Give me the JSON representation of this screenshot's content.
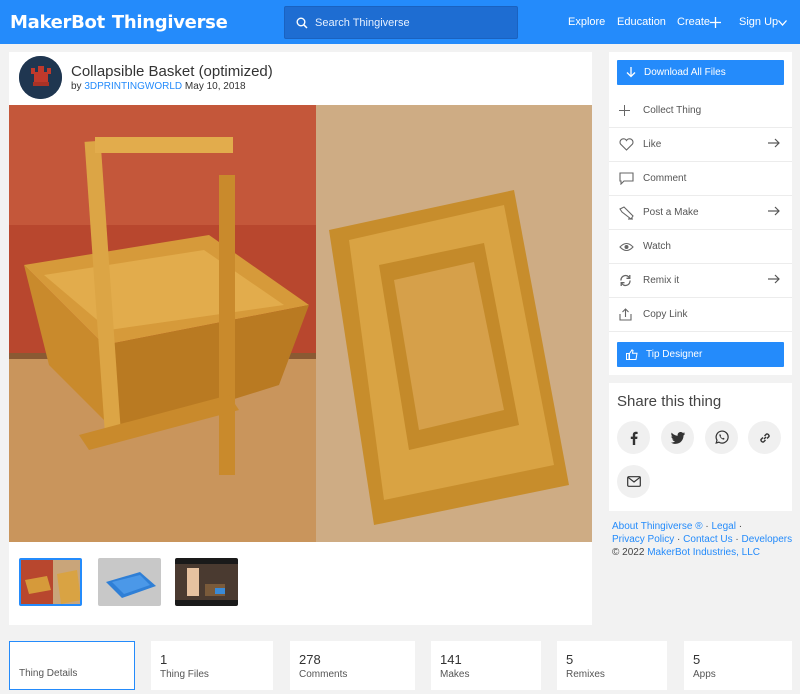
{
  "header": {
    "logo_brand": "MakerBot",
    "logo_product": "Thingiverse",
    "search_placeholder": "Search Thingiverse",
    "nav": {
      "explore": "Explore",
      "education": "Education",
      "create": "Create",
      "signup": "Sign Up"
    }
  },
  "thing": {
    "title": "Collapsible Basket (optimized)",
    "by_prefix": "by",
    "author": "3DPRINTINGWORLD",
    "date": "May 10, 2018"
  },
  "actions": {
    "download": "Download All Files",
    "collect": "Collect Thing",
    "like": "Like",
    "comment": "Comment",
    "post_make": "Post a Make",
    "watch": "Watch",
    "remix": "Remix it",
    "copy_link": "Copy Link",
    "tip": "Tip Designer"
  },
  "share": {
    "title": "Share this thing",
    "icons": [
      "facebook-icon",
      "twitter-icon",
      "whatsapp-icon",
      "link-icon",
      "email-icon"
    ]
  },
  "footer": {
    "about": "About Thingiverse ®",
    "legal": "Legal",
    "privacy": "Privacy Policy",
    "contact": "Contact Us",
    "developers": "Developers",
    "copyright_prefix": "© 2022",
    "company": "MakerBot Industries, LLC",
    "sep": "·"
  },
  "tabs": [
    {
      "count": "",
      "label": "Thing Details"
    },
    {
      "count": "1",
      "label": "Thing Files"
    },
    {
      "count": "278",
      "label": "Comments"
    },
    {
      "count": "141",
      "label": "Makes"
    },
    {
      "count": "5",
      "label": "Remixes"
    },
    {
      "count": "5",
      "label": "Apps"
    }
  ],
  "colors": {
    "brand_blue": "#248bfb",
    "search_bg": "#1e6dd2",
    "page_bg": "#f2f2f2"
  }
}
